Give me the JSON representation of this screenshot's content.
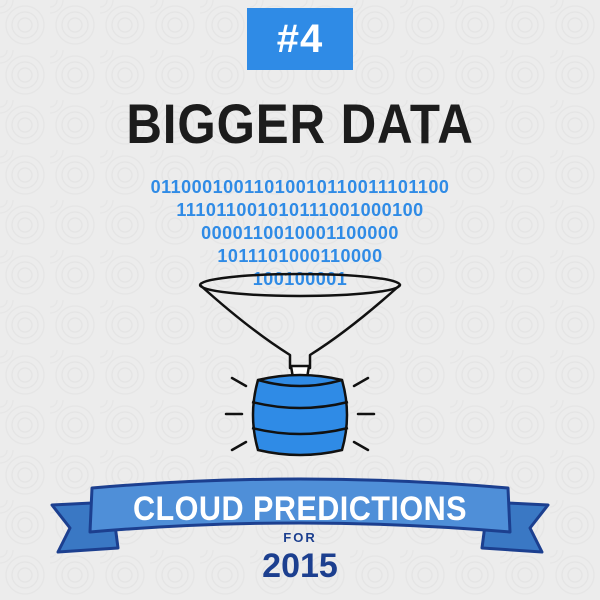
{
  "badge": {
    "text": "#4"
  },
  "headline": {
    "text": "BIGGER DATA"
  },
  "binary": {
    "lines": [
      "01100010011010010110011101100",
      "111011001010111001000100",
      "0000110010001100000",
      "1011101000110000",
      "100100001"
    ]
  },
  "banner": {
    "text": "CLOUD PREDICTIONS"
  },
  "subtitle": {
    "for_label": "FOR",
    "year": "2015"
  },
  "colors": {
    "accent": "#2f8be6",
    "headline": "#1c1c1c",
    "banner_fill": "#4f8fd8",
    "banner_outline": "#1c3f8f",
    "year": "#1c3f8f",
    "background": "#ececec"
  },
  "icons": [
    "funnel-icon",
    "database-icon",
    "motion-lines-icon"
  ]
}
